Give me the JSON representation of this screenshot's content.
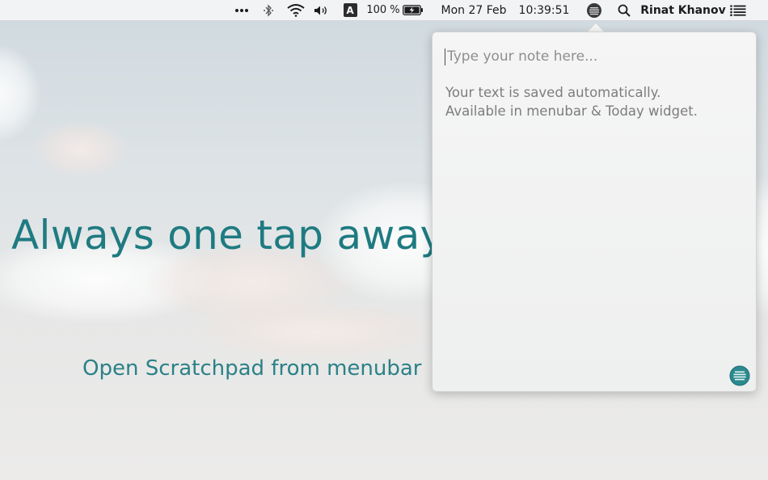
{
  "menubar": {
    "more_icon": "ellipsis-icon",
    "bluetooth_icon": "bluetooth-icon",
    "wifi_icon": "wifi-icon",
    "volume_icon": "volume-icon",
    "input_source_label": "A",
    "battery_percent": "100 %",
    "battery_level": 100,
    "date": "Mon 27 Feb",
    "time": "10:39:51",
    "scratchpad_icon": "scratchpad-menubar-icon",
    "spotlight_icon": "search-icon",
    "user_name": "Rinat Khanov",
    "notification_icon": "notification-center-icon"
  },
  "hero": {
    "headline": "Always one tap away",
    "subline": "Open Scratchpad from menubar"
  },
  "popover": {
    "note_value": "",
    "note_placeholder": "Type your note here...",
    "hint_line1": "Your text is saved automatically.",
    "hint_line2": "Available in menubar & Today widget.",
    "app_icon": "scratchpad-app-icon"
  },
  "colors": {
    "accent": "#1e7b81",
    "icon_fill": "#2a8a8f",
    "menubar_bg": "#f4f4f6"
  }
}
